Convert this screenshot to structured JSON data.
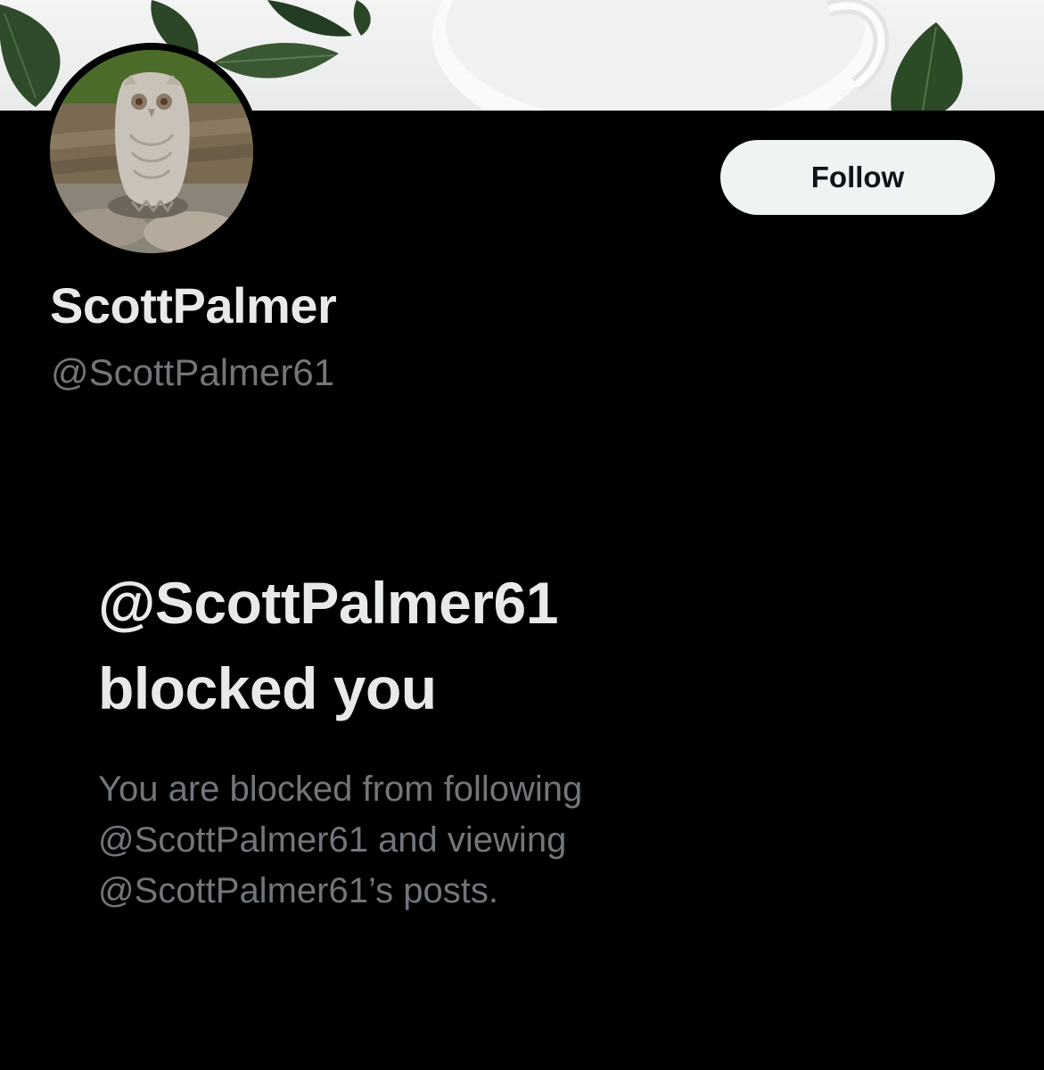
{
  "profile": {
    "display_name": "ScottPalmer",
    "handle": "@ScottPalmer61",
    "avatar_icon": "owl-statue-photo",
    "banner_icon": "leaves-and-teacup-photo"
  },
  "follow_button": {
    "label": "Follow"
  },
  "blocked_notice": {
    "title_line1": "@ScottPalmer61",
    "title_line2": "blocked you",
    "body_line1": "You are blocked from following",
    "body_line2": "@ScottPalmer61 and viewing",
    "body_line3": "@ScottPalmer61’s posts."
  },
  "colors": {
    "background": "#000000",
    "primary_text": "#e7e9ea",
    "secondary_text": "#71767b",
    "button_bg": "#eff3f4",
    "button_text": "#0f1419"
  }
}
